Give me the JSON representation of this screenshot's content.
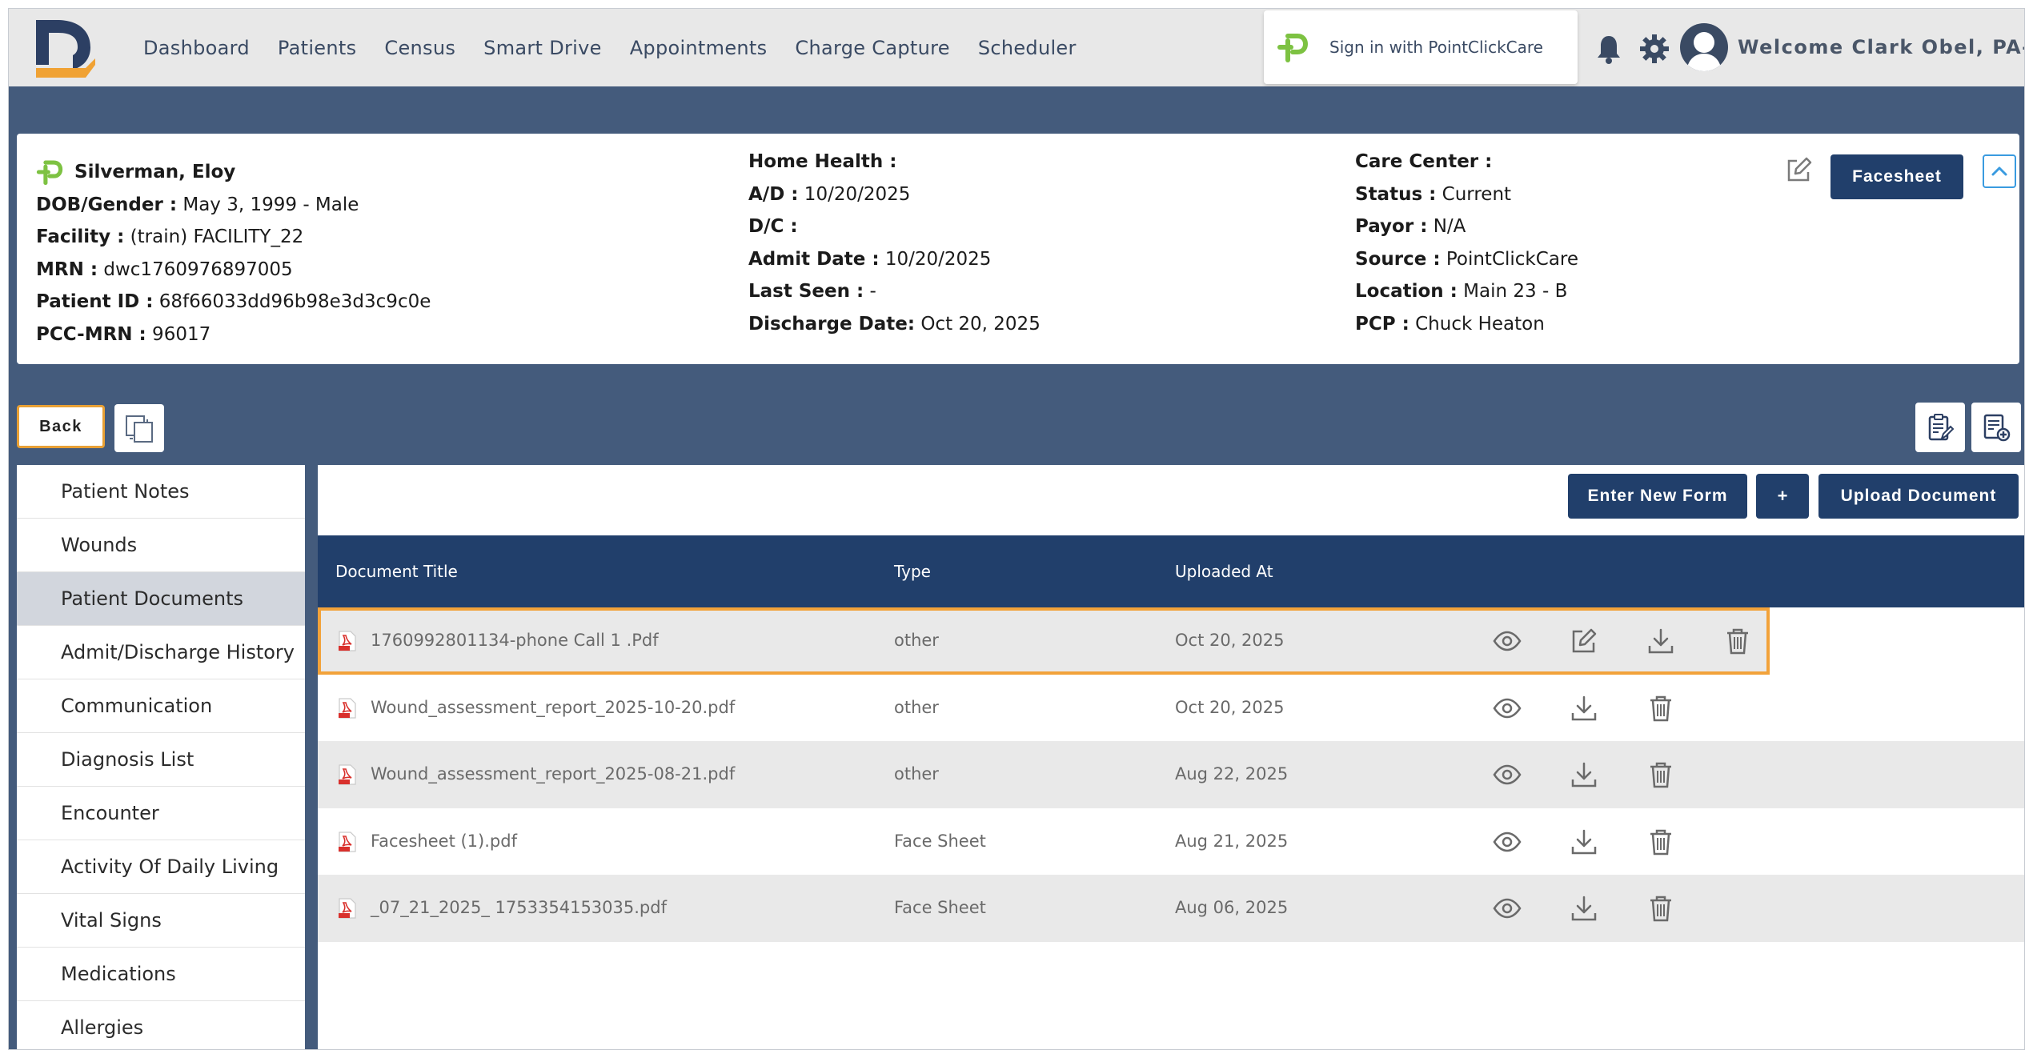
{
  "nav": {
    "items": [
      "Dashboard",
      "Patients",
      "Census",
      "Smart Drive",
      "Appointments",
      "Charge Capture",
      "Scheduler"
    ],
    "pcc_signin": "Sign in with PointClickCare",
    "welcome": "Welcome Clark Obel, PA-C"
  },
  "patient": {
    "name": "Silverman, Eloy",
    "col1": [
      {
        "label": "DOB/Gender :",
        "value": " May 3, 1999 - Male"
      },
      {
        "label": "Facility :",
        "value": " (train) FACILITY_22"
      },
      {
        "label": "MRN :",
        "value": " dwc1760976897005"
      },
      {
        "label": "Patient ID :",
        "value": " 68f66033dd96b98e3d3c9c0e"
      },
      {
        "label": "PCC-MRN :",
        "value": " 96017"
      }
    ],
    "col2": [
      {
        "label": "Home Health :",
        "value": ""
      },
      {
        "label": "A/D :",
        "value": " 10/20/2025"
      },
      {
        "label": "D/C :",
        "value": ""
      },
      {
        "label": "Admit Date :",
        "value": " 10/20/2025"
      },
      {
        "label": "Last Seen :",
        "value": " -"
      },
      {
        "label": "Discharge Date:",
        "value": " Oct 20, 2025"
      }
    ],
    "col3": [
      {
        "label": "Care Center :",
        "value": ""
      },
      {
        "label": "Status :",
        "value": " Current"
      },
      {
        "label": "Payor :",
        "value": " N/A"
      },
      {
        "label": "Source :",
        "value": " PointClickCare"
      },
      {
        "label": "Location :",
        "value": " Main 23 - B"
      },
      {
        "label": "PCP :",
        "value": " Chuck Heaton"
      }
    ],
    "facesheet_label": "Facesheet"
  },
  "actions": {
    "back_label": "Back",
    "enter_form_label": "Enter New Form",
    "plus_label": "+",
    "upload_label": "Upload Document"
  },
  "sidebar": {
    "items": [
      {
        "label": "Patient Notes",
        "active": false
      },
      {
        "label": "Wounds",
        "active": false
      },
      {
        "label": "Patient Documents",
        "active": true
      },
      {
        "label": "Admit/Discharge History",
        "active": false
      },
      {
        "label": "Communication",
        "active": false
      },
      {
        "label": "Diagnosis List",
        "active": false
      },
      {
        "label": "Encounter",
        "active": false
      },
      {
        "label": "Activity Of Daily Living",
        "active": false
      },
      {
        "label": "Vital Signs",
        "active": false
      },
      {
        "label": "Medications",
        "active": false
      },
      {
        "label": "Allergies",
        "active": false
      }
    ]
  },
  "documents": {
    "columns": [
      "Document Title",
      "Type",
      "Uploaded At"
    ],
    "rows": [
      {
        "title": "1760992801134-phone Call 1 .Pdf",
        "type": "other",
        "uploaded": "Oct 20, 2025",
        "editable": true,
        "selected": true
      },
      {
        "title": "Wound_assessment_report_2025-10-20.pdf",
        "type": "other",
        "uploaded": "Oct 20, 2025",
        "editable": false,
        "selected": false
      },
      {
        "title": "Wound_assessment_report_2025-08-21.pdf",
        "type": "other",
        "uploaded": "Aug 22, 2025",
        "editable": false,
        "selected": false
      },
      {
        "title": "Facesheet (1).pdf",
        "type": "Face Sheet",
        "uploaded": "Aug 21, 2025",
        "editable": false,
        "selected": false
      },
      {
        "title": "_07_21_2025_ 1753354153035.pdf",
        "type": "Face Sheet",
        "uploaded": "Aug 06, 2025",
        "editable": false,
        "selected": false
      }
    ]
  },
  "colors": {
    "brand_blue": "#213f6b",
    "page_band": "#445b7c",
    "highlight": "#f2a23a",
    "pcc_green": "#7dc242"
  }
}
